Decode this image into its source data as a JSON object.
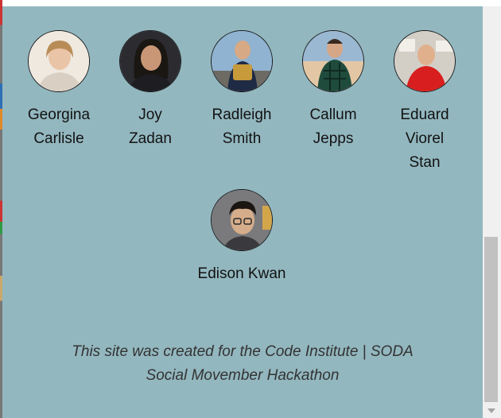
{
  "team": [
    {
      "name_line1": "Georgina",
      "name_line2": "Carlisle",
      "name_line3": "",
      "avatar": "person-icon",
      "photo_bg": "#e9e1d6"
    },
    {
      "name_line1": "Joy",
      "name_line2": "Zadan",
      "name_line3": "",
      "avatar": "person-icon",
      "photo_bg": "#2b2b30"
    },
    {
      "name_line1": "Radleigh",
      "name_line2": "Smith",
      "name_line3": "",
      "avatar": "person-icon",
      "photo_bg": "#7ea3c2"
    },
    {
      "name_line1": "Callum",
      "name_line2": "Jepps",
      "name_line3": "",
      "avatar": "person-icon",
      "photo_bg": "#8fb0c9"
    },
    {
      "name_line1": "Eduard",
      "name_line2": "Viorel",
      "name_line3": "Stan",
      "avatar": "person-icon",
      "photo_bg": "#c9c4bd"
    },
    {
      "name_line1": "Edison Kwan",
      "name_line2": "",
      "name_line3": "",
      "avatar": "person-icon",
      "photo_bg": "#6d6d6f"
    }
  ],
  "footer": {
    "line1": "This site was created for the Code Institute | SODA",
    "line2": "Social Movember Hackathon"
  },
  "colors": {
    "page_bg": "#93b7bf",
    "text": "#121212",
    "footer_text": "#333333"
  }
}
